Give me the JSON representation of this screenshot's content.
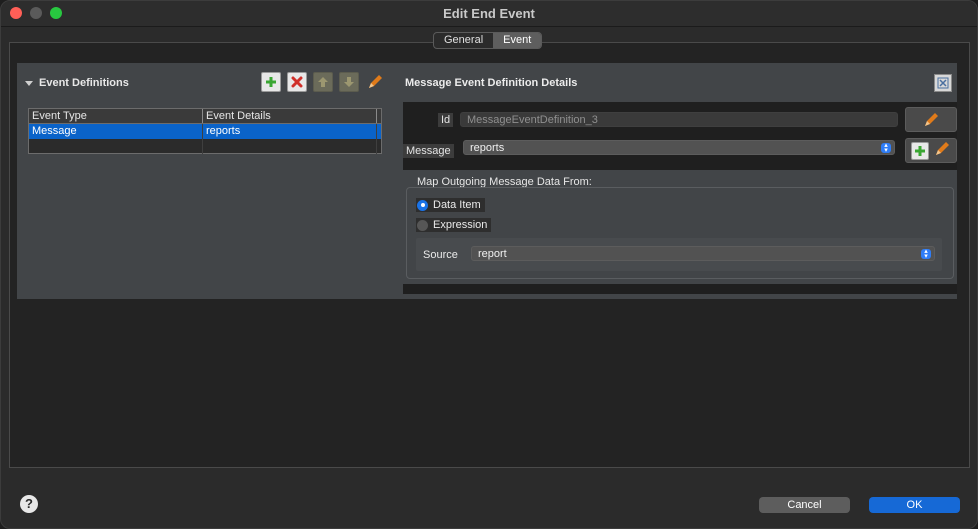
{
  "window": {
    "title": "Edit End Event"
  },
  "tabs": [
    {
      "label": "General",
      "active": false
    },
    {
      "label": "Event",
      "active": true
    }
  ],
  "event_definitions": {
    "title": "Event Definitions",
    "columns": [
      "Event Type",
      "Event Details"
    ],
    "rows": [
      {
        "type": "Message",
        "details": "reports",
        "selected": true
      }
    ]
  },
  "details": {
    "title": "Message Event Definition Details",
    "id_label": "Id",
    "id_value": "MessageEventDefinition_3",
    "message_label": "Message",
    "message_value": "reports",
    "map_title": "Map Outgoing Message Data From:",
    "radio_data_item": "Data Item",
    "radio_expression": "Expression",
    "source_label": "Source",
    "source_value": "report"
  },
  "footer": {
    "help": "?",
    "cancel": "Cancel",
    "ok": "OK"
  },
  "colors": {
    "accent": "#1669d6",
    "selection": "#0a63c9",
    "add_green": "#3aa632",
    "delete_red": "#d0302a",
    "edit_orange": "#e07b1a"
  }
}
